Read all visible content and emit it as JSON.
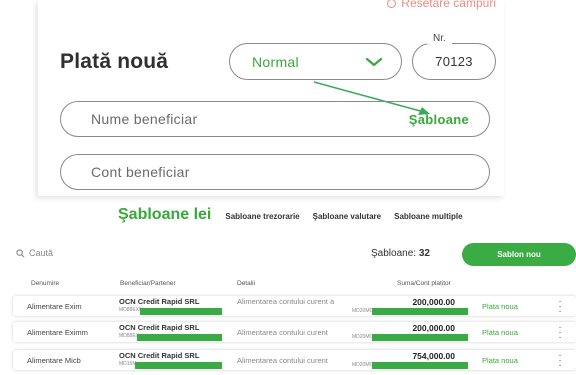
{
  "form": {
    "reset_label": "Resetare câmpuri",
    "title": "Plată nouă",
    "payment_type": "Normal",
    "number_label": "Nr.",
    "number_value": "70123",
    "beneficiary_placeholder": "Nume beneficiar",
    "templates_link": "Şabloane",
    "account_placeholder": "Cont beneficiar"
  },
  "templates": {
    "tabs": [
      "Şabloane lei",
      "Sabloane trezorarie",
      "Şabloane valutare",
      "Sabloane multiple"
    ],
    "search_placeholder": "Caută",
    "count_label": "Şabloane:",
    "count_value": "32",
    "new_button": "Sablon nou",
    "columns": [
      "Denumire",
      "Beneficiar/Partener",
      "Detalii",
      "Suma/Cont platitor"
    ],
    "rows": [
      {
        "name": "Alimentare Exim",
        "beneficiary": "OCN Credit Rapid SRL",
        "beneficiary_code": "MD88EX0",
        "details": "Alimentarea contului curent a",
        "amount": "200,000.00",
        "account": "MD20MO",
        "action": "Plata noua"
      },
      {
        "name": "Alimentare Eximm",
        "beneficiary": "OCN Credit Rapid SRL",
        "beneficiary_code": "MD88EX",
        "details": "Alimentarea contului curent",
        "amount": "200,000.00",
        "account": "MD20MO",
        "action": "Plata noua"
      },
      {
        "name": "Alimentare Micb",
        "beneficiary": "OCN Credit Rapid SRL",
        "beneficiary_code": "MD15M",
        "details": "Alimentarea contului curent",
        "amount": "754,000.00",
        "account": "MD20MO",
        "action": "Plata noua"
      }
    ]
  },
  "colors": {
    "accent": "#39a83a",
    "button": "#3bab44",
    "reset": "#e25b4b"
  },
  "icons": {
    "search": "search-icon",
    "select_arrow": "chevron-down-icon",
    "row_menu": "more-vertical-icon",
    "reset": "reset-icon"
  }
}
